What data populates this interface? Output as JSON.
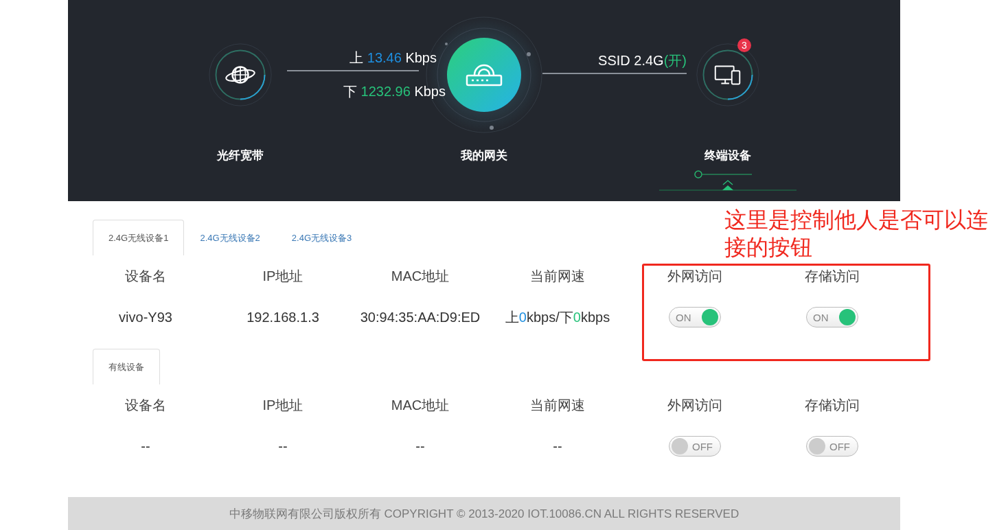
{
  "hero": {
    "nodes": [
      {
        "label": "光纤宽带"
      },
      {
        "label": "我的网关"
      },
      {
        "label": "终端设备",
        "selected": true,
        "badge": "3"
      }
    ],
    "upload": {
      "label": "上",
      "value": "13.46",
      "unit": "Kbps"
    },
    "download": {
      "label": "下",
      "value": "1232.96",
      "unit": "Kbps"
    },
    "ssid": {
      "name": "SSID 2.4G",
      "status": "(开)"
    }
  },
  "sections": [
    {
      "tabs": [
        {
          "label": "2.4G无线设备1",
          "selected": true
        },
        {
          "label": "2.4G无线设备2",
          "selected": false
        },
        {
          "label": "2.4G无线设备3",
          "selected": false
        }
      ],
      "columns": [
        "设备名",
        "IP地址",
        "MAC地址",
        "当前网速",
        "外网访问",
        "存储访问"
      ],
      "rows": [
        {
          "cells": [
            {
              "kind": "text",
              "text": "vivo-Y93"
            },
            {
              "kind": "text",
              "text": "192.168.1.3"
            },
            {
              "kind": "text",
              "text": "30:94:35:AA:D9:ED"
            },
            {
              "kind": "rate",
              "up_label": "上",
              "up_value": "0",
              "middle": "kbps/下",
              "down_value": "0",
              "unit": "kbps"
            },
            {
              "kind": "toggle",
              "on": true,
              "label": "ON"
            },
            {
              "kind": "toggle",
              "on": true,
              "label": "ON"
            }
          ]
        }
      ]
    },
    {
      "tabs": [
        {
          "label": "有线设备",
          "selected": true
        }
      ],
      "columns": [
        "设备名",
        "IP地址",
        "MAC地址",
        "当前网速",
        "外网访问",
        "存储访问"
      ],
      "rows": [
        {
          "cells": [
            {
              "kind": "text",
              "text": "--"
            },
            {
              "kind": "text",
              "text": "--"
            },
            {
              "kind": "text",
              "text": "--"
            },
            {
              "kind": "text",
              "text": "--"
            },
            {
              "kind": "toggle",
              "on": false,
              "label": "OFF"
            },
            {
              "kind": "toggle",
              "on": false,
              "label": "OFF"
            }
          ]
        }
      ]
    }
  ],
  "footer": "中移物联网有限公司版权所有 COPYRIGHT © 2013-2020 IOT.10086.CN ALL RIGHTS RESERVED",
  "annotation": {
    "text": "这里是控制他人是否可以连接的按钮"
  }
}
